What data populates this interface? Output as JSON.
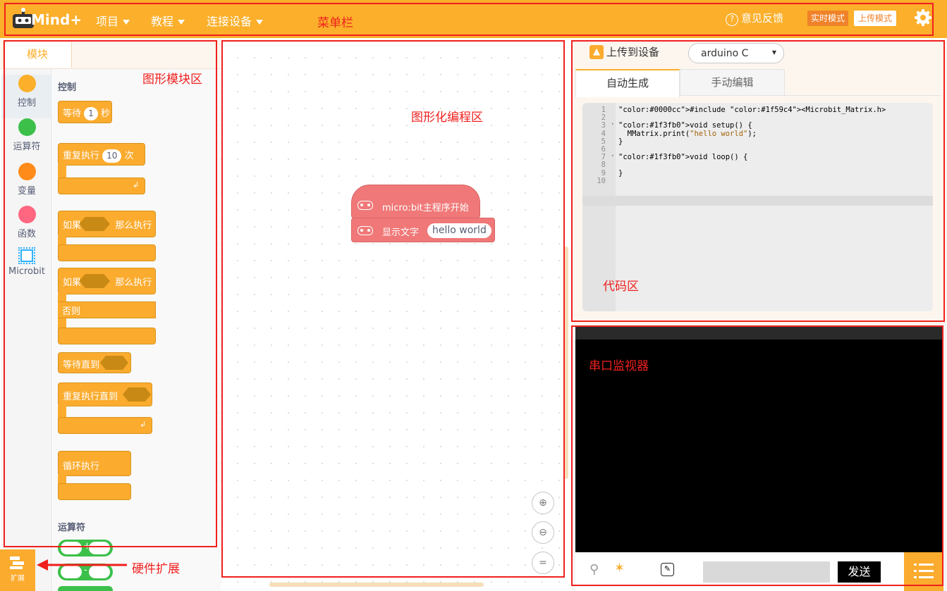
{
  "topbar": {
    "logo": "Mind+",
    "menu": [
      "项目",
      "教程",
      "连接设备"
    ],
    "feedback": "意见反馈",
    "mode_realtime": "实时模式",
    "mode_upload": "上传模式"
  },
  "left": {
    "tab": "模块",
    "categories": [
      {
        "label": "控制",
        "color": "#fbaf2a"
      },
      {
        "label": "运算符",
        "color": "#3cc04a"
      },
      {
        "label": "变量",
        "color": "#ff8c1a"
      },
      {
        "label": "函数",
        "color": "#ff6680"
      },
      {
        "label": "Microbit",
        "color": "#2eb2ff"
      }
    ],
    "section_control": "控制",
    "section_operators": "运算符",
    "blocks": {
      "wait": "等待",
      "wait_value": "1",
      "wait_unit": "秒",
      "repeat": "重复执行",
      "repeat_value": "10",
      "repeat_unit": "次",
      "if_then": "如果",
      "then_do": "那么执行",
      "else": "否则",
      "wait_until": "等待直到",
      "repeat_until": "重复执行直到",
      "forever": "循环执行",
      "plus": "+",
      "minus": "-"
    },
    "extension_label": "扩展"
  },
  "workspace": {
    "hat_block": "micro:bit主程序开始",
    "show_text": "显示文字",
    "show_text_value": "hello world",
    "zoom_in": "⊕",
    "zoom_out": "⊖",
    "reset": "="
  },
  "code": {
    "upload_button": "上传到设备",
    "target": "arduino C",
    "tabs": [
      "自动生成",
      "手动编辑"
    ],
    "lines": [
      {
        "n": "1",
        "text": "#include <Microbit_Matrix.h>"
      },
      {
        "n": "2",
        "text": ""
      },
      {
        "n": "3",
        "text": "void setup() {"
      },
      {
        "n": "4",
        "text": "  MMatrix.print(\"hello world\");"
      },
      {
        "n": "5",
        "text": "}"
      },
      {
        "n": "6",
        "text": ""
      },
      {
        "n": "7",
        "text": "void loop() {"
      },
      {
        "n": "8",
        "text": ""
      },
      {
        "n": "9",
        "text": "}"
      },
      {
        "n": "10",
        "text": ""
      }
    ]
  },
  "serial": {
    "send_button": "发送",
    "input_value": ""
  },
  "annotations": {
    "menubar": "菜单栏",
    "blocks_area": "图形模块区",
    "programming_area": "图形化编程区",
    "code_area": "代码区",
    "serial_monitor": "串口监视器",
    "hardware_ext": "硬件扩展"
  }
}
